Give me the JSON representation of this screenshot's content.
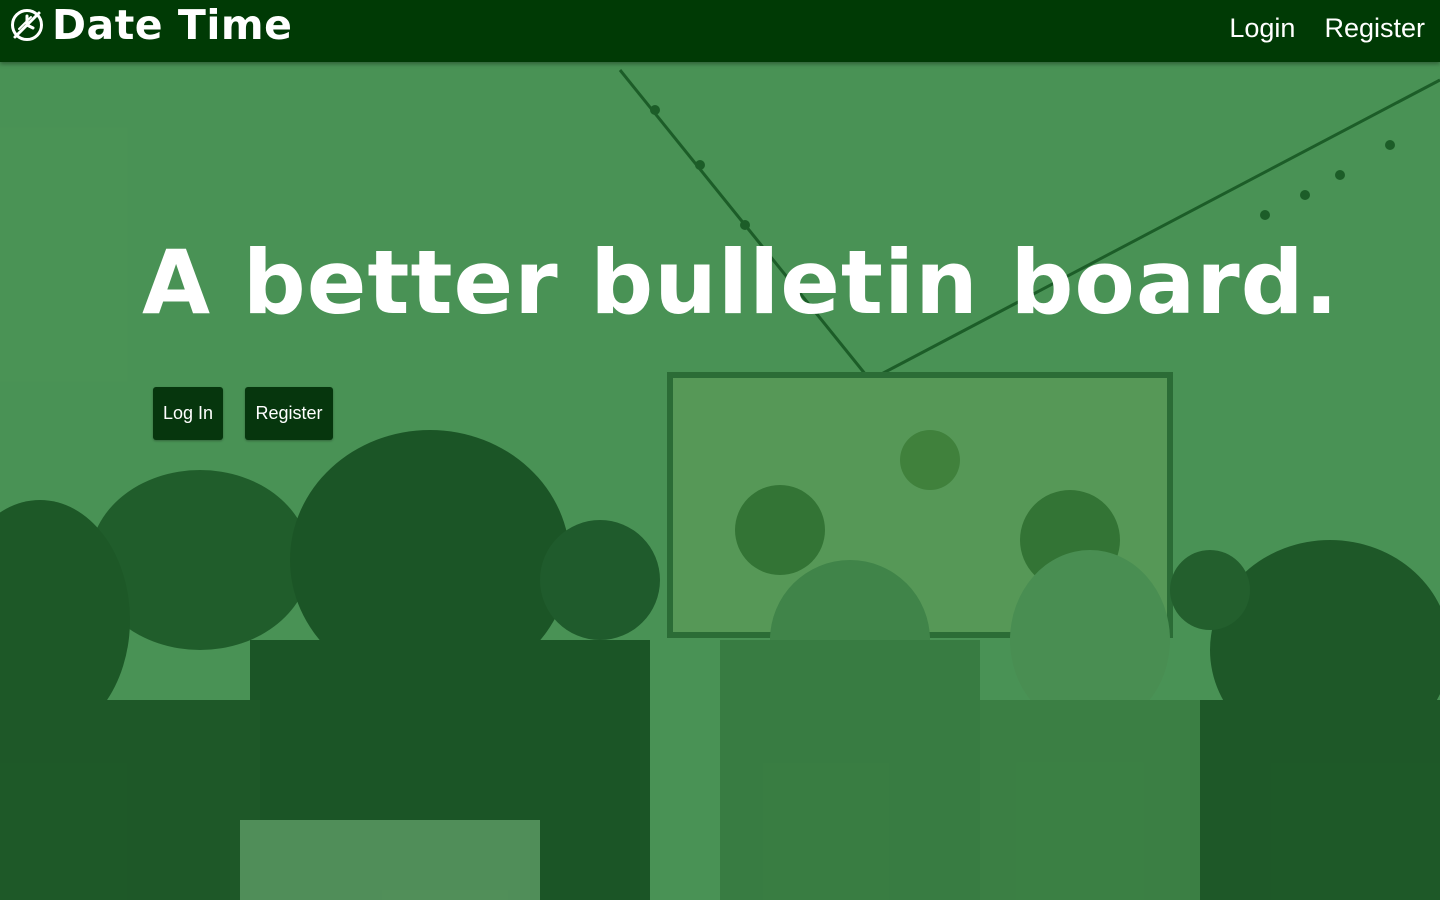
{
  "navbar": {
    "brand_name": "Date Time",
    "brand_icon": "no-clock-icon",
    "links": [
      {
        "label": "Login"
      },
      {
        "label": "Register"
      }
    ]
  },
  "hero": {
    "headline": "A better bulletin board.",
    "buttons": {
      "login_label": "Log In",
      "register_label": "Register"
    }
  },
  "colors": {
    "navbar_bg": "#003a05",
    "overlay": "#1e6e2d",
    "button_bg": "#06360d",
    "text": "#ffffff"
  }
}
